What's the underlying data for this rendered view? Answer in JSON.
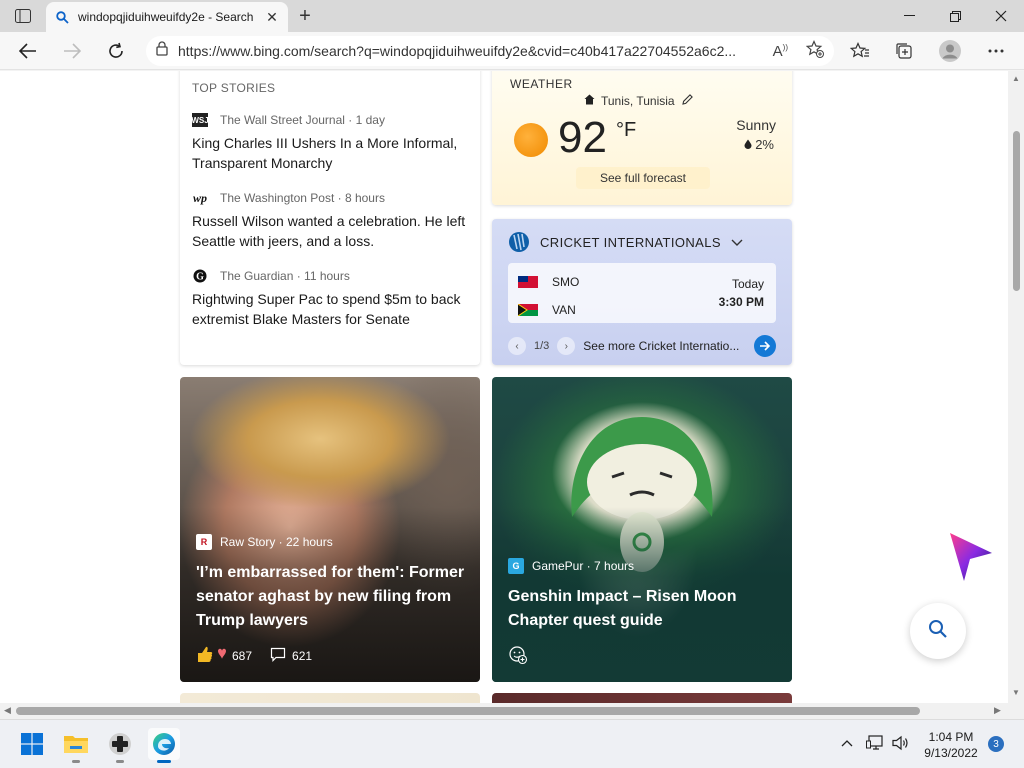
{
  "browser": {
    "tab_title": "windopqjiduihweuifdy2e - Search",
    "url": "https://www.bing.com/search?q=windopqjiduihweuifdy2e&cvid=c40b417a22704552a6c2..."
  },
  "top_stories": {
    "heading": "TOP STORIES",
    "items": [
      {
        "source": "The Wall Street Journal · 1 day",
        "logo": "WSJ",
        "headline": "King Charles III Ushers In a More Informal, Transparent Monarchy"
      },
      {
        "source": "The Washington Post · 8 hours",
        "logo": "wp",
        "headline": "Russell Wilson wanted a celebration. He left Seattle with jeers, and a loss."
      },
      {
        "source": "The Guardian · 11 hours",
        "logo": "G",
        "headline": "Rightwing Super Pac to spend $5m to back extremist Blake Masters for Senate"
      }
    ]
  },
  "weather": {
    "label": "WEATHER",
    "location": "Tunis, Tunisia",
    "temp": "92",
    "unit": "°F",
    "condition": "Sunny",
    "precip": "2%",
    "forecast_link": "See full forecast"
  },
  "cricket": {
    "title": "CRICKET INTERNATIONALS",
    "team1": "SMO",
    "team2": "VAN",
    "day": "Today",
    "time": "3:30 PM",
    "pager": "1/3",
    "more_link": "See more Cricket Internatio..."
  },
  "cards": [
    {
      "source": "Raw Story · 22 hours",
      "logo": "R",
      "headline": "'I’m embarrassed for them': Former senator aghast by new filing from Trump lawyers",
      "reactions": "687",
      "comments": "621"
    },
    {
      "source": "GamePur · 7 hours",
      "logo": "G",
      "headline": "Genshin Impact – Risen Moon Chapter quest guide"
    }
  ],
  "taskbar": {
    "time": "1:04 PM",
    "date": "9/13/2022",
    "notifications": "3"
  },
  "colors": {
    "accent": "#0067c0",
    "cricket_go": "#1479d6"
  }
}
